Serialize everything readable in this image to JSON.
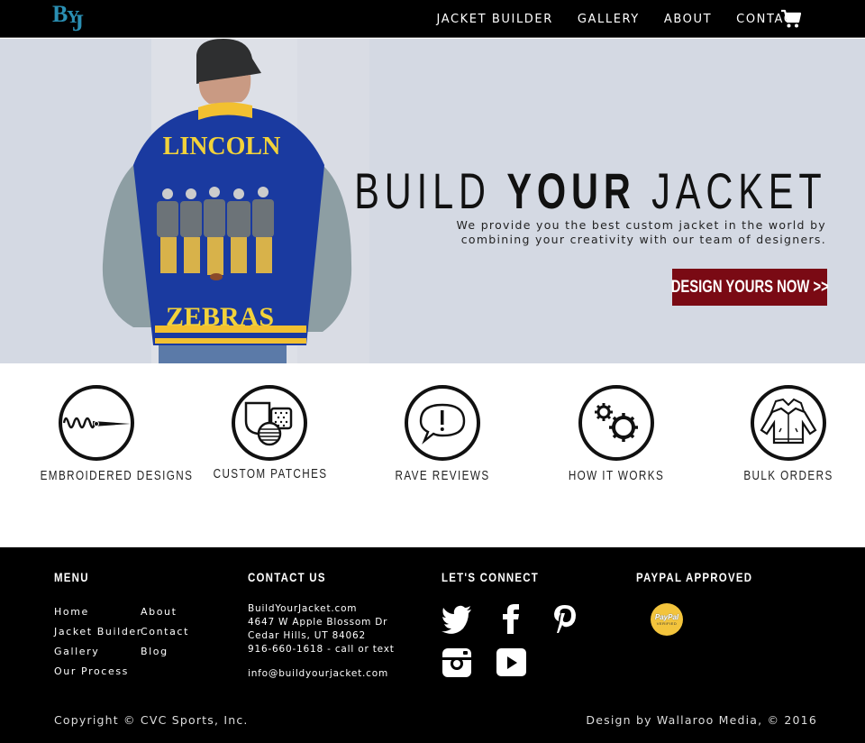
{
  "header": {
    "logo_text": {
      "b": "B",
      "y": "Y",
      "j": "J"
    },
    "nav": [
      "JACKET BUILDER",
      "GALLERY",
      "ABOUT",
      "CONTACT"
    ],
    "cart_icon": "shopping-cart-icon"
  },
  "hero": {
    "title_parts": [
      "BUILD ",
      "YOUR",
      " JACKET"
    ],
    "subtitle_line1": "We provide you the best custom jacket in the world by",
    "subtitle_line2": "combining your creativity with our team of designers.",
    "cta_label": "DESIGN YOURS NOW >>",
    "jacket_text_top": "LINCOLN",
    "jacket_text_bottom": "ZEBRAS",
    "colors": {
      "background": "#d4d9e3",
      "cta": "#7a0a14",
      "jacket": "#1a3aa0",
      "lettering": "#f2d23a",
      "sleeves": "#8d9ea3"
    }
  },
  "features": [
    {
      "label": "EMBROIDERED DESIGNS",
      "icon": "embroidery-needle-icon"
    },
    {
      "label": "CUSTOM PATCHES",
      "icon": "patches-icon"
    },
    {
      "label": "RAVE REVIEWS",
      "icon": "speech-bubble-icon"
    },
    {
      "label": "HOW IT WORKS",
      "icon": "gears-icon"
    },
    {
      "label": "BULK ORDERS",
      "icon": "jackets-icon"
    }
  ],
  "footer": {
    "menu": {
      "title": "MENU",
      "col1": [
        "Home",
        "Jacket Builder",
        "Gallery",
        "Our Process"
      ],
      "col2": [
        "About",
        "Contact",
        "Blog"
      ]
    },
    "contact": {
      "title": "CONTACT US",
      "lines": [
        "BuildYourJacket.com",
        "4647 W Apple Blossom Dr",
        "Cedar Hills, UT 84062",
        "916-660-1618 - call or text"
      ],
      "email": "info@buildyourjacket.com"
    },
    "connect": {
      "title": "LET'S CONNECT",
      "icons": [
        "twitter-icon",
        "facebook-icon",
        "pinterest-icon",
        "instagram-icon",
        "youtube-icon"
      ]
    },
    "paypal": {
      "title": "PAYPAL APPROVED",
      "badge_text": "PayPal",
      "badge_sub": "VERIFIED"
    },
    "copyright": "Copyright © CVC Sports, Inc.",
    "credit": "Design by Wallaroo Media, © 2016"
  }
}
